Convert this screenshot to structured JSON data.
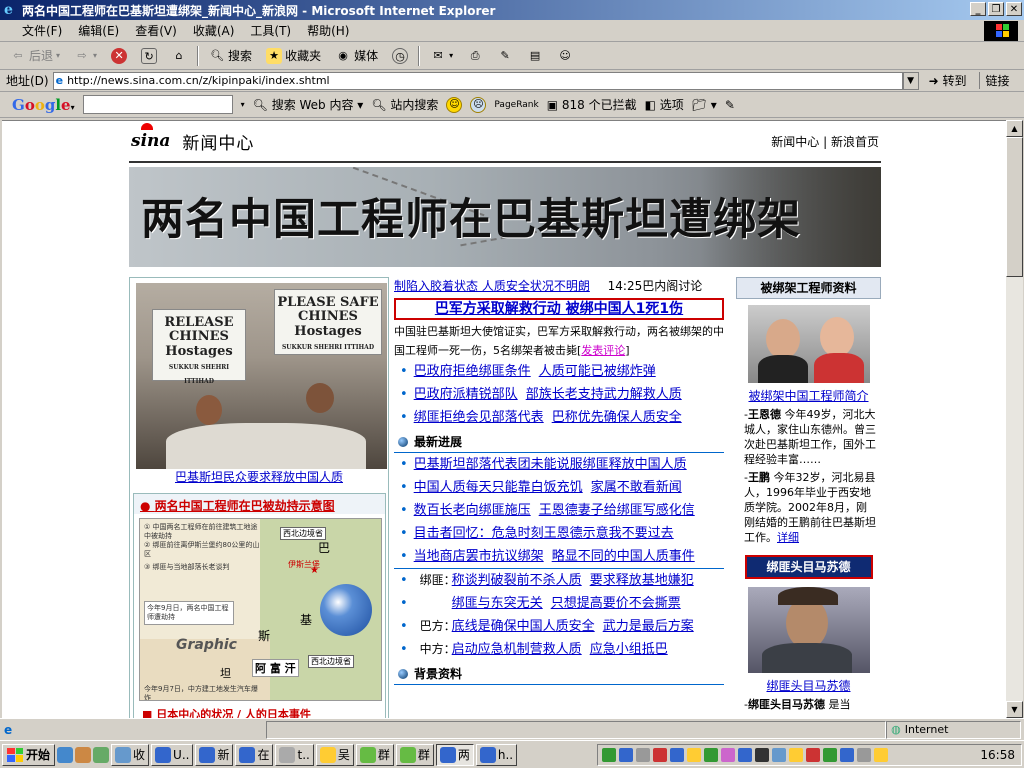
{
  "window": {
    "title": "两名中国工程师在巴基斯坦遭绑架_新闻中心_新浪网 - Microsoft Internet Explorer"
  },
  "menu": [
    "文件(F)",
    "编辑(E)",
    "查看(V)",
    "收藏(A)",
    "工具(T)",
    "帮助(H)"
  ],
  "toolbar": {
    "back": "后退",
    "search": "搜索",
    "favorites": "收藏夹",
    "media": "媒体"
  },
  "address": {
    "label": "地址(D)",
    "url": "http://news.sina.com.cn/z/kipinpaki/index.shtml",
    "go": "转到",
    "links": "链接"
  },
  "googlebar": {
    "logo": [
      "G",
      "o",
      "o",
      "g",
      "l",
      "e"
    ],
    "search_web": "搜索 Web 内容",
    "site_search": "站内搜索",
    "pagerank": "PageRank",
    "blocked": "818 个已拦截",
    "options": "选项"
  },
  "site": {
    "logo": "sina",
    "section": "新闻中心",
    "nav": [
      "新闻中心",
      "新浪首页"
    ],
    "banner_title": "两名中国工程师在巴基斯坦遭绑架"
  },
  "left": {
    "photo_signs": [
      "RELEASE CHINES Hostages",
      "PLEASE SAFE CHINES Hostages",
      "SUKKUR SHEHRI ITTIHAD",
      "SUKKUR SHEHRI ITTIHAD"
    ],
    "photo_caption": "巴基斯坦民众要求释放中国人质",
    "map_title": "两名中国工程师在巴被劫持示意图",
    "map_labels": [
      "西北边境省",
      "伊斯兰堡",
      "巴",
      "基",
      "斯",
      "阿 富 汗",
      "西北边境省",
      "坦",
      "Graphic"
    ],
    "map_notes": [
      "① 中国两名工程师在前往建筑工地途中被劫持",
      "② 绑匪前往离伊斯兰堡约80公里的山区",
      "③ 绑匪与当地部落长老谈判",
      "今年9月日，两名中国工程师遭劫持",
      "今年9月7日，中方建工地发生汽车爆炸"
    ],
    "map_bottom": "■ 日本中心的状况 / 人的日本事件"
  },
  "middle": {
    "ticker": "制陷入胶着状态  人质安全状况不明朗",
    "ticker_time": "14:25巴内阁讨论",
    "headline": "巴军方采取解救行动  被绑中国人1死1伤",
    "summary": "中国驻巴基斯坦大使馆证实，巴军方采取解救行动，两名被绑架的中国工程师一死一伤，5名绑架者被击毙",
    "comment": "发表评论",
    "bullets1": [
      [
        "巴政府拒绝绑匪条件",
        "人质可能已被绑炸弹"
      ],
      [
        "巴政府派精锐部队",
        "部族长老支持武力解救人质"
      ],
      [
        "绑匪拒绝会见部落代表",
        "巴称优先确保人质安全"
      ]
    ],
    "section1": "最新进展",
    "bullets2": [
      [
        "巴基斯坦部落代表团未能说服绑匪释放中国人质"
      ],
      [
        "中国人质每天只能靠白饭充饥",
        "家属不敢看新闻"
      ],
      [
        "数百长老向绑匪施压",
        "王恩德妻子给绑匪写感化信"
      ],
      [
        "目击者回忆：危急时刻王恩德示意我不要过去"
      ],
      [
        "当地商店罢市抗议绑架",
        "略显不同的中国人质事件"
      ]
    ],
    "labeled": [
      {
        "label": "绑匪：",
        "links": [
          "称谈判破裂前不杀人质",
          "要求释放基地嫌犯"
        ]
      },
      {
        "label": "",
        "links": [
          "绑匪与东突无关",
          "只想提高要价不会撕票"
        ]
      },
      {
        "label": "巴方：",
        "links": [
          "底线是确保中国人质安全",
          "武力是最后方案"
        ]
      },
      {
        "label": "中方：",
        "links": [
          "启动应急机制营救人质",
          "应急小组抵巴"
        ]
      }
    ],
    "section2": "背景资料"
  },
  "right": {
    "header": "被绑架工程师资料",
    "photo_caption": "被绑架中国工程师简介",
    "bio1_name": "王恩德",
    "bio1": "今年49岁，河北大城人，家住山东德州。曾三次赴巴基斯坦工作，国外工程经验丰富……",
    "bio2_name": "王鹏",
    "bio2": "今年32岁，河北易县人，1996年毕业于西安地质学院。2002年8月，刚刚结婚的王鹏前往巴基斯坦工作。",
    "more": "详细",
    "button": "绑匪头目马苏德",
    "photo2_caption": "绑匪头目马苏德",
    "bio3_name": "绑匪头目马苏德",
    "bio3": "是当"
  },
  "status": {
    "zone": "Internet"
  },
  "taskbar": {
    "start": "开始",
    "tasks": [
      "收",
      "U..",
      "新",
      "在",
      "t..",
      "吴",
      "群",
      "群",
      "两",
      "h.."
    ],
    "clock": "16:58"
  }
}
